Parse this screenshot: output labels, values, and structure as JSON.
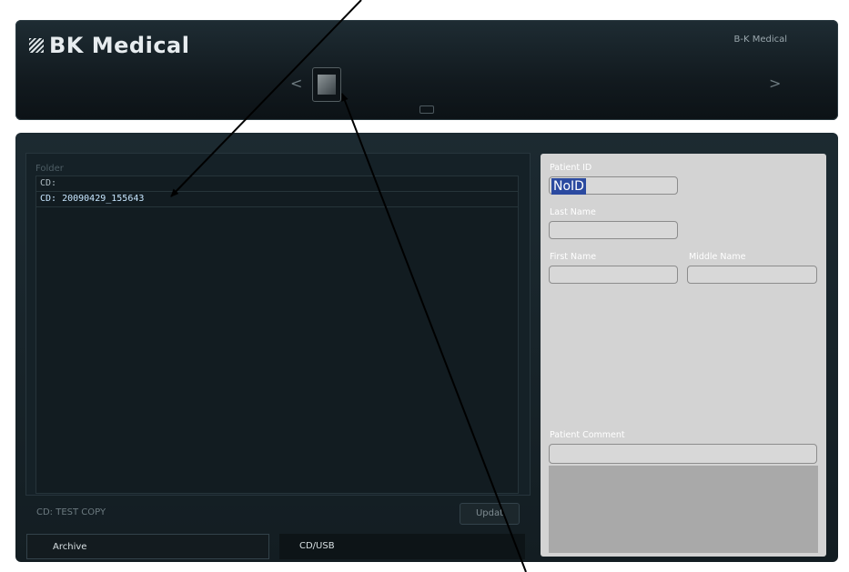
{
  "header": {
    "logo_text": "BK Medical",
    "brand_small": "B-K Medical",
    "nav_prev": "<",
    "nav_next": ">"
  },
  "browser": {
    "folder_label": "Folder",
    "folders": [
      "CD:",
      "CD: 20090429_155643"
    ],
    "status_text": "CD: TEST COPY",
    "update_label": "Updat"
  },
  "tabs": {
    "archive": "Archive",
    "cdusb": "CD/USB"
  },
  "patient": {
    "id_label": "Patient ID",
    "id_value": "NoID",
    "last_name_label": "Last Name",
    "first_name_label": "First Name",
    "middle_name_label": "Middle Name",
    "comment_label": "Patient Comment"
  }
}
